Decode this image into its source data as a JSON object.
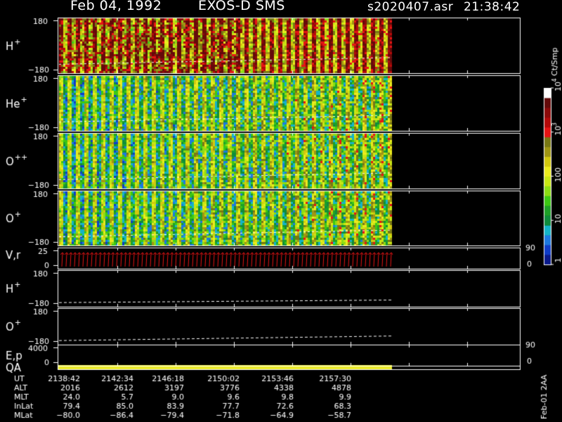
{
  "header": {
    "date": "Feb 04, 1992",
    "instrument": "EXOS-D SMS",
    "file": "s2020407.asr",
    "time": "21:38:42"
  },
  "colorbar": {
    "unit_label": "Ct/Smp",
    "tick_labels": [
      "1",
      "10",
      "100",
      "10",
      "10"
    ],
    "tick_exponents": [
      "",
      "",
      "",
      "3",
      "4"
    ],
    "colors": [
      "#0a1a8c",
      "#0f3cc8",
      "#1c78e0",
      "#14b4c8",
      "#0f8c3c",
      "#1ea028",
      "#3cc814",
      "#8cdc14",
      "#c8e614",
      "#ebeb1e",
      "#d2c80f",
      "#a09614",
      "#787814",
      "#e61414",
      "#b40a0a",
      "#8c0a0a",
      "#640a0a",
      "#ffffff"
    ]
  },
  "panels": [
    {
      "name": "H+",
      "label": "H",
      "sup": "+",
      "top": "180",
      "bottom": "-180",
      "kind": "spec",
      "bias": 0.68
    },
    {
      "name": "He+",
      "label": "He",
      "sup": "+",
      "top": "180",
      "bottom": "-180",
      "kind": "spec",
      "bias": 0.38
    },
    {
      "name": "O++",
      "label": "O",
      "sup": "++",
      "top": "180",
      "bottom": "-180",
      "kind": "spec",
      "bias": 0.38
    },
    {
      "name": "O+",
      "label": "O",
      "sup": "+",
      "top": "180",
      "bottom": "-180",
      "kind": "spec",
      "bias": 0.38
    },
    {
      "name": "V,r",
      "label": "V,r",
      "sup": "",
      "top": "25",
      "bottom": "0",
      "right_top": "90",
      "right_bottom": "0",
      "kind": "vr"
    },
    {
      "name": "H+ line",
      "label": "H",
      "sup": "+",
      "top": "180",
      "bottom": "-180",
      "kind": "line",
      "y0": -140,
      "y1": -115
    },
    {
      "name": "O+ line",
      "label": "O",
      "sup": "+",
      "top": "180",
      "bottom": "-180",
      "kind": "line",
      "y0": -140,
      "y1": -95
    },
    {
      "name": "E,p",
      "label": "E,p",
      "sup": "",
      "top": "4000",
      "bottom": "0",
      "right_top": "90",
      "right_bottom": "0",
      "label2": "QA",
      "kind": "qa"
    }
  ],
  "footer": {
    "row_labels": [
      "UT",
      "ALT",
      "MLT",
      "InLat",
      "MLat"
    ],
    "columns": [
      [
        "2138:42",
        "2016",
        "24.0",
        "79.4",
        "-80.0"
      ],
      [
        "2142:34",
        "2612",
        "5.7",
        "85.0",
        "-86.4"
      ],
      [
        "2146:18",
        "3197",
        "9.0",
        "83.9",
        "-79.4"
      ],
      [
        "2150:02",
        "3776",
        "9.6",
        "77.7",
        "-71.8"
      ],
      [
        "2153:46",
        "4338",
        "9.8",
        "72.6",
        "-64.9"
      ],
      [
        "2157:30",
        "4878",
        "9.9",
        "68.3",
        "-58.7"
      ]
    ],
    "side_label": "Feb-01 2AA"
  },
  "chart_data": {
    "type": "heatmap",
    "title": "Feb 04, 1992   EXOS-D SMS",
    "x_ticks": [
      "2138:42",
      "2142:34",
      "2146:18",
      "2150:02",
      "2153:46",
      "2157:30"
    ],
    "panels": [
      "H+",
      "He+",
      "O++",
      "O+",
      "V,r",
      "H+",
      "O+",
      "E,p"
    ],
    "colorbar_unit": "Ct/Smp",
    "colorbar_scale": "log",
    "colorbar_range": [
      1,
      10000
    ]
  }
}
